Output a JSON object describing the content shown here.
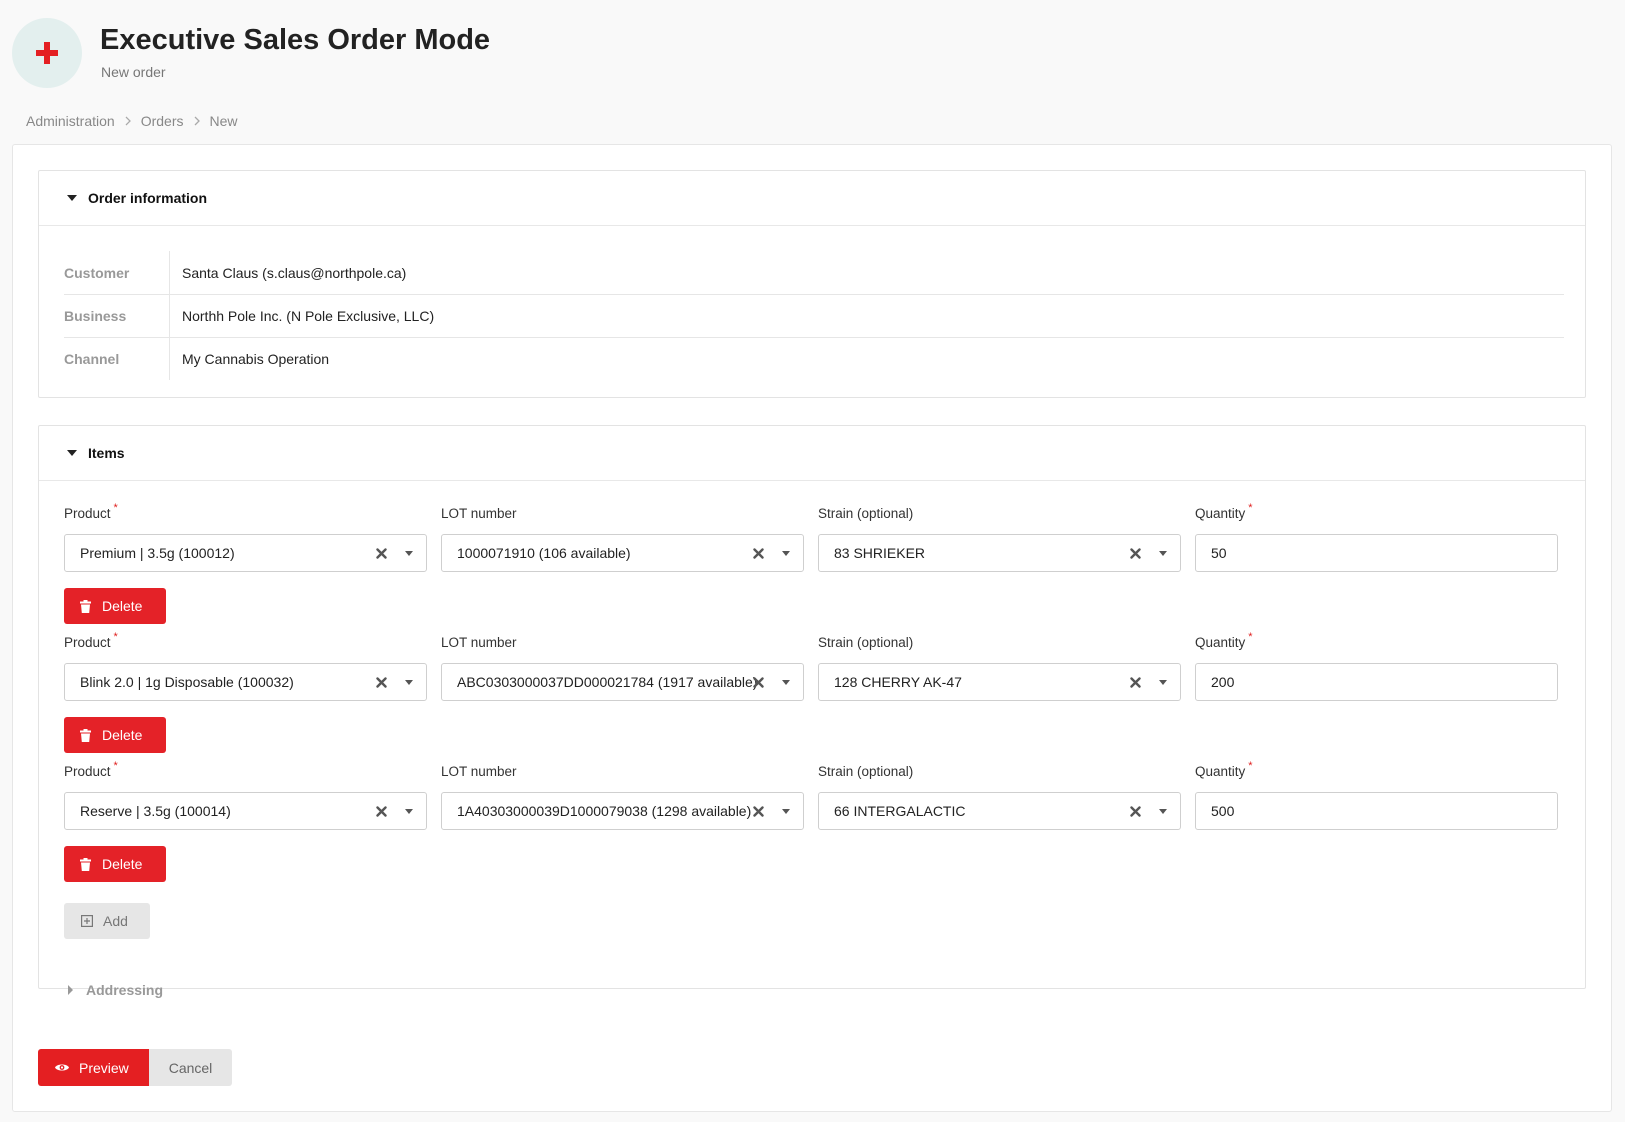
{
  "header": {
    "title": "Executive Sales Order Mode",
    "subtitle": "New order",
    "icon": "plus-icon",
    "accent_color": "#e41f22",
    "icon_bg": "#e3efee"
  },
  "breadcrumb": [
    "Administration",
    "Orders",
    "New"
  ],
  "order_info": {
    "title": "Order information",
    "rows": [
      {
        "label": "Customer",
        "value": "Santa Claus (s.claus@northpole.ca)"
      },
      {
        "label": "Business",
        "value": "Northh Pole Inc. (N Pole Exclusive, LLC)"
      },
      {
        "label": "Channel",
        "value": "My Cannabis Operation"
      }
    ]
  },
  "items": {
    "title": "Items",
    "labels": {
      "product": "Product",
      "lot": "LOT number",
      "strain": "Strain (optional)",
      "quantity": "Quantity",
      "required_mark": "*"
    },
    "rows": [
      {
        "product": "Premium | 3.5g (100012)",
        "lot": "1000071910 (106 available)",
        "strain": "83 SHRIEKER",
        "quantity": "50"
      },
      {
        "product": "Blink 2.0 | 1g Disposable (100032)",
        "lot": "ABC0303000037DD000021784 (1917 available)",
        "strain": "128 CHERRY AK-47",
        "quantity": "200"
      },
      {
        "product": "Reserve | 3.5g (100014)",
        "lot": "1A40303000039D1000079038 (1298 available)",
        "strain": "66 INTERGALACTIC",
        "quantity": "500"
      }
    ],
    "delete_label": "Delete",
    "add_label": "Add"
  },
  "addressing": {
    "label": "Addressing"
  },
  "footer": {
    "preview_label": "Preview",
    "cancel_label": "Cancel"
  }
}
